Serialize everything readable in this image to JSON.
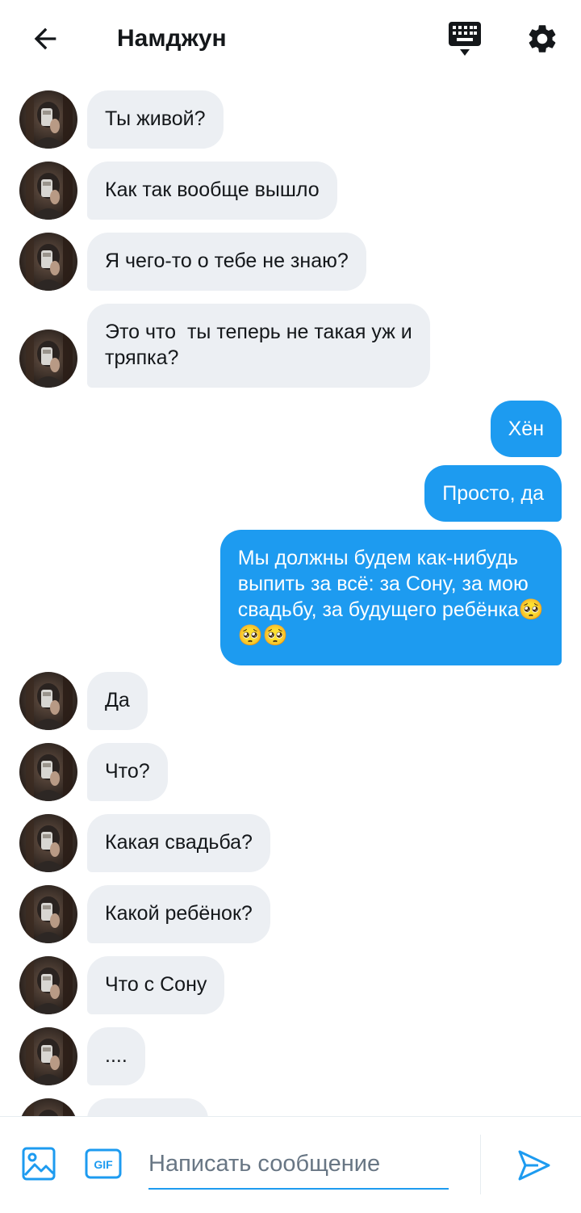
{
  "header": {
    "title": "Намджун",
    "back_icon": "arrow-left-icon",
    "keyboard_icon": "keyboard-icon",
    "settings_icon": "gear-icon"
  },
  "colors": {
    "accent": "#1d9bf0",
    "incoming_bubble": "#eceff3",
    "text": "#14171a",
    "placeholder": "#687684"
  },
  "messages": [
    {
      "dir": "in",
      "text": "Ты живой?"
    },
    {
      "dir": "in",
      "text": "Как так вообще вышло"
    },
    {
      "dir": "in",
      "text": "Я чего-то о тебе не знаю?"
    },
    {
      "dir": "in",
      "text": "Это что  ты теперь не такая уж и\nтряпка?"
    },
    {
      "dir": "out",
      "text": "Хён"
    },
    {
      "dir": "out",
      "text": "Просто, да"
    },
    {
      "dir": "out",
      "text": "Мы должны будем как-нибудь\nвыпить за всё: за Сону, за мою\nсвадьбу, за будущего ребёнка🥺\n🥺🥺"
    },
    {
      "dir": "in",
      "text": "Да"
    },
    {
      "dir": "in",
      "text": "Что?"
    },
    {
      "dir": "in",
      "text": "Какая свадьба?"
    },
    {
      "dir": "in",
      "text": "Какой ребёнок?"
    },
    {
      "dir": "in",
      "text": "Что с Сону"
    },
    {
      "dir": "in",
      "text": "...."
    },
    {
      "dir": "in",
      "text": ""
    }
  ],
  "composer": {
    "placeholder": "Написать сообщение",
    "image_icon": "image-icon",
    "gif_icon": "gif-icon",
    "gif_label": "GIF",
    "send_icon": "send-icon"
  }
}
